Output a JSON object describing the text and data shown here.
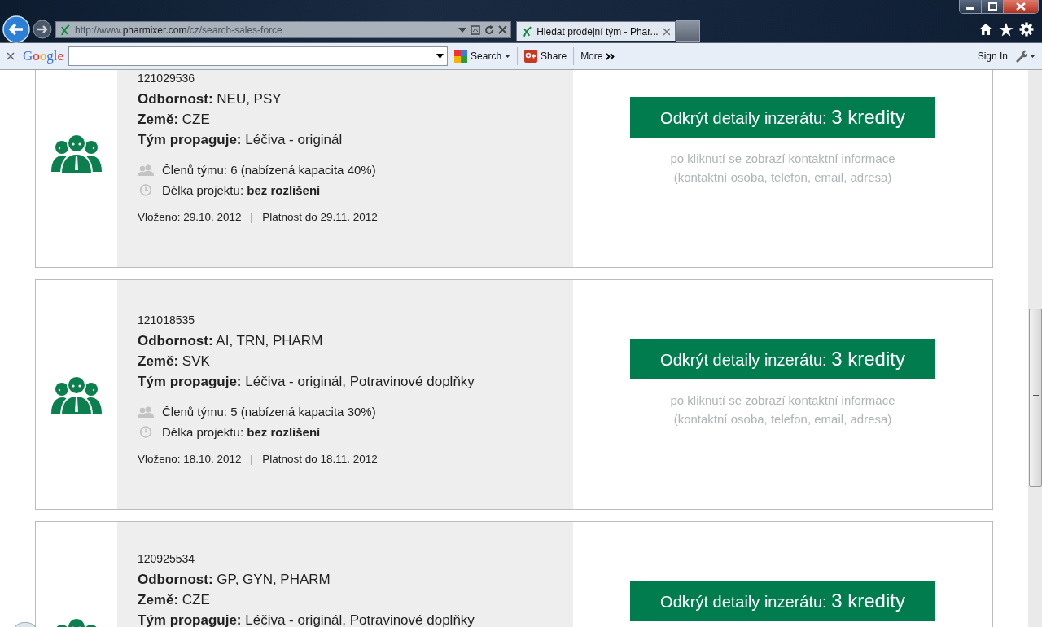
{
  "browser": {
    "address": {
      "prefix": "http://www.",
      "domain": "pharmixer.com",
      "path": "/cz/search-sales-force"
    },
    "tabs": [
      {
        "title": "Hledat prodejní tým - Phar...",
        "selected": true
      }
    ],
    "toolbar": {
      "logo": "Google",
      "search": "Search",
      "share": "Share",
      "more": "More",
      "sign_in": "Sign In"
    }
  },
  "listings": [
    {
      "id": "121029536",
      "expertise_label": "Odbornost:",
      "expertise": "NEU, PSY",
      "country_label": "Země:",
      "country": "CZE",
      "promotes_label": "Tým propaguje:",
      "promotes": "Léčiva - originál",
      "members": "Členů týmu: 6 (nabízená kapacita 40%)",
      "duration": "Délka projektu: **bez rozlišení**",
      "posted": "Vloženo: 29.10. 2012",
      "separator": "|",
      "valid": "Platnost do 29.11. 2012",
      "button_text": "Odkrýt detaily inzerátu:",
      "button_price": "3 kredity",
      "note": "po kliknutí se zobrazí kontaktní informace",
      "note_detail": "(kontaktní osoba, telefon, email, adresa)"
    },
    {
      "id": "121018535",
      "expertise_label": "Odbornost:",
      "expertise": "AI, TRN, PHARM",
      "country_label": "Země:",
      "country": "SVK",
      "promotes_label": "Tým propaguje:",
      "promotes": "Léčiva - originál, Potravinové doplňky",
      "members": "Členů týmu: 5 (nabízená kapacita 30%)",
      "duration": "Délka projektu: **bez rozlišení**",
      "posted": "Vloženo: 18.10. 2012",
      "separator": "|",
      "valid": "Platnost do 18.11. 2012",
      "button_text": "Odkrýt detaily inzerátu:",
      "button_price": "3 kredity",
      "note": "po kliknutí se zobrazí kontaktní informace",
      "note_detail": "(kontaktní osoba, telefon, email, adresa)"
    },
    {
      "id": "120925534",
      "expertise_label": "Odbornost:",
      "expertise": "GP, GYN, PHARM",
      "country_label": "Země:",
      "country": "CZE",
      "promotes_label": "Tým propaguje:",
      "promotes": "Léčiva - originál, Potravinové doplňky",
      "button_text": "Odkrýt detaily inzerátu:",
      "button_price": "3 kredity"
    }
  ]
}
